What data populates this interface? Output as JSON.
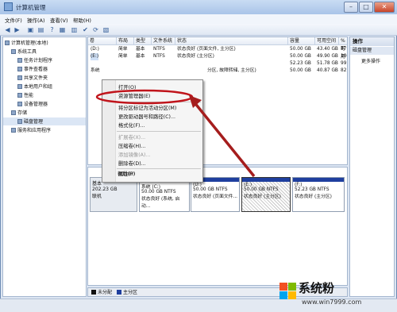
{
  "window": {
    "title": "计算机管理"
  },
  "menu": [
    "文件(F)",
    "操作(A)",
    "查看(V)",
    "帮助(H)"
  ],
  "tree": [
    {
      "label": "计算机管理(本地)",
      "indent": 0
    },
    {
      "label": "系统工具",
      "indent": 1
    },
    {
      "label": "任务计划程序",
      "indent": 2
    },
    {
      "label": "事件查看器",
      "indent": 2
    },
    {
      "label": "共享文件夹",
      "indent": 2
    },
    {
      "label": "本地用户和组",
      "indent": 2
    },
    {
      "label": "性能",
      "indent": 2
    },
    {
      "label": "设备管理器",
      "indent": 2
    },
    {
      "label": "存储",
      "indent": 1
    },
    {
      "label": "磁盘管理",
      "indent": 2
    },
    {
      "label": "服务和应用程序",
      "indent": 1
    }
  ],
  "columns": [
    "卷",
    "布局",
    "类型",
    "文件系统",
    "状态",
    "容量",
    "可用空间",
    "% 可用"
  ],
  "volumes": [
    {
      "vol": "(D:)",
      "layout": "简单",
      "type": "基本",
      "fs": "NTFS",
      "status": "状态良好 (页面文件, 主分区)",
      "cap": "50.00 GB",
      "free": "43.40 GB",
      "pct": "87 %"
    },
    {
      "vol": "(E:)",
      "layout": "简单",
      "type": "基本",
      "fs": "NTFS",
      "status": "状态良好 (主分区)",
      "cap": "50.00 GB",
      "free": "49.90 GB",
      "pct": "100 %"
    },
    {
      "vol": "",
      "layout": "",
      "type": "",
      "fs": "",
      "status": "",
      "cap": "52.23 GB",
      "free": "51.78 GB",
      "pct": "99 %"
    },
    {
      "vol": "系统",
      "layout": "",
      "type": "",
      "fs": "",
      "status": "分区, 故障转储, 主分区)",
      "cap": "50.00 GB",
      "free": "40.87 GB",
      "pct": "82 %"
    }
  ],
  "context_menu": [
    {
      "label": "打开(O)",
      "enabled": true
    },
    {
      "label": "资源管理器(E)",
      "enabled": true
    },
    {
      "sep": true
    },
    {
      "label": "将分区标记为活动分区(M)",
      "enabled": true
    },
    {
      "label": "更改驱动器号和路径(C)...",
      "enabled": true
    },
    {
      "label": "格式化(F)...",
      "enabled": true
    },
    {
      "sep": true
    },
    {
      "label": "扩展卷(X)...",
      "enabled": false
    },
    {
      "label": "压缩卷(H)...",
      "enabled": true
    },
    {
      "label": "添加镜像(A)...",
      "enabled": false
    },
    {
      "label": "删除卷(D)...",
      "enabled": true
    },
    {
      "sep": true
    },
    {
      "label": "属性(P)",
      "enabled": true
    },
    {
      "sep": true
    },
    {
      "label": "帮助(H)",
      "enabled": true
    }
  ],
  "disk": {
    "name": "基本",
    "size": "202.23 GB",
    "status": "联机",
    "partitions": [
      {
        "title": "系统 (C:)",
        "size": "50.00 GB NTFS",
        "status": "状态良好 (系统, 启动...",
        "selected": false
      },
      {
        "title": "(D:)",
        "size": "50.00 GB NTFS",
        "status": "状态良好 (页面文件...",
        "selected": false
      },
      {
        "title": "(E:)",
        "size": "50.00 GB NTFS",
        "status": "状态良好 (主分区)",
        "selected": true
      },
      {
        "title": "(F:)",
        "size": "52.23 GB NTFS",
        "status": "状态良好 (主分区)",
        "selected": false
      }
    ]
  },
  "legend": [
    {
      "label": "未分配",
      "color": "#111111"
    },
    {
      "label": "主分区",
      "color": "#1f3f9e"
    }
  ],
  "actions": {
    "title": "操作",
    "section": "磁盘管理",
    "more": "更多操作"
  },
  "watermark": {
    "text": "系统粉",
    "url": "www.win7999.com"
  },
  "colors": {
    "highlight_ellipse": "#c0141b",
    "arrow": "#a51d1d"
  }
}
